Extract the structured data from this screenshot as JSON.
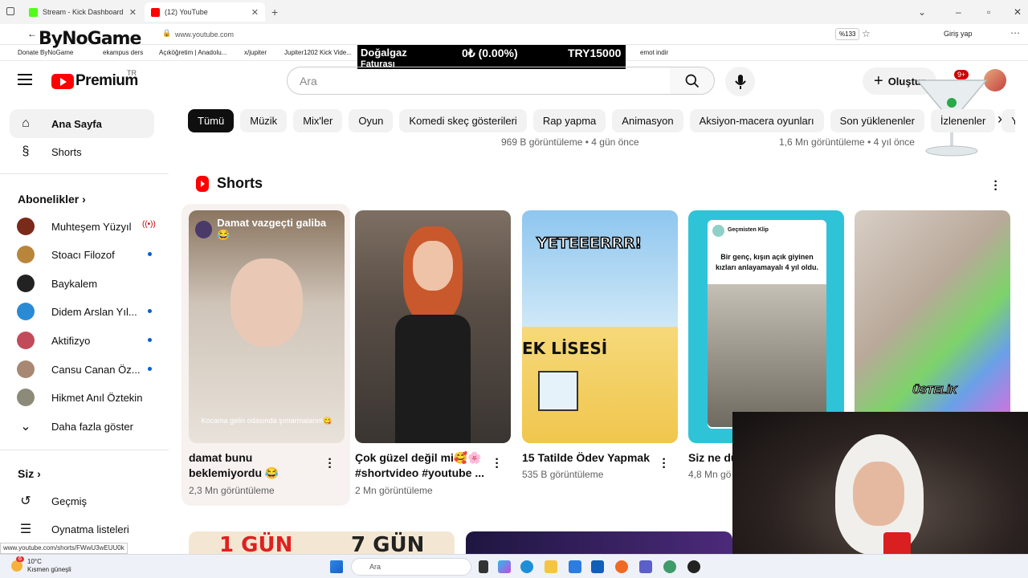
{
  "browser": {
    "tabs": [
      {
        "title": "Stream - Kick Dashboard",
        "favicon_color": "#53fc18"
      },
      {
        "title": "(12) YouTube",
        "favicon_color": "#ff0000"
      }
    ],
    "url": "www.youtube.com",
    "zoom": "%133",
    "signin_label": "Giriş yap",
    "bookmarks": [
      "Donate ByNoGame",
      "ekampus ders",
      "Açıköğretim | Anadolu...",
      "x/jupiter",
      "Jupiter1202 Kick Vide...",
      "emot indir"
    ],
    "status_url": "www.youtube.com/shorts/FWwU3wEUU0k"
  },
  "overlay": {
    "logo_text": "ByNoGame",
    "ticker_left": "Doğalgaz",
    "ticker_sub": "Faturası",
    "ticker_mid": "0₺ (0.00%)",
    "ticker_right": "TRY15000"
  },
  "header": {
    "brand": "Premium",
    "region": "TR",
    "search_placeholder": "Ara",
    "create_label": "Oluştur",
    "notification_count": "9+"
  },
  "sidebar": {
    "main": [
      {
        "label": "Ana Sayfa",
        "icon": "home-icon"
      },
      {
        "label": "Shorts",
        "icon": "shorts-icon"
      }
    ],
    "subscriptions_title": "Abonelikler",
    "subscriptions": [
      {
        "label": "Muhteşem Yüzyıl",
        "color": "#7a2a1a",
        "status": "live"
      },
      {
        "label": "Stoacı Filozof",
        "color": "#b8863b",
        "status": "new"
      },
      {
        "label": "Baykalem",
        "color": "#222222",
        "status": ""
      },
      {
        "label": "Didem Arslan Yıl...",
        "color": "#2a8ad4",
        "status": "new"
      },
      {
        "label": "Aktifizyo",
        "color": "#c24b5a",
        "status": "new"
      },
      {
        "label": "Cansu Canan Öz...",
        "color": "#a88872",
        "status": "new"
      },
      {
        "label": "Hikmet Anıl Öztekin",
        "color": "#8d8a7a",
        "status": ""
      }
    ],
    "show_more": "Daha fazla göster",
    "you_title": "Siz",
    "you_items": [
      {
        "label": "Geçmiş",
        "icon": "history-icon"
      },
      {
        "label": "Oynatma listeleri",
        "icon": "playlist-icon"
      }
    ]
  },
  "chips": [
    "Tümü",
    "Müzik",
    "Mix'ler",
    "Oyun",
    "Komedi skeç gösterileri",
    "Rap yapma",
    "Animasyon",
    "Aksiyon-macera oyunları",
    "Son yüklenenler",
    "İzlenenler",
    "Yo"
  ],
  "previous_row_meta": [
    "969 B görüntüleme • 4 gün önce",
    "1,6 Mn görüntüleme • 4 yıl önce"
  ],
  "shorts": {
    "title": "Shorts",
    "items": [
      {
        "title": "damat bunu beklemiyordu 😂",
        "views": "2,3 Mn görüntüleme",
        "overlay": "Damat vazgeçti galiba 😂",
        "caption": "Kocama gelin odasında şımarmalarım😋"
      },
      {
        "title": "Çok güzel değil mi🥰🌸 #shortvideo #youtube ...",
        "views": "2 Mn görüntüleme"
      },
      {
        "title": "15 Tatilde Ödev Yapmak",
        "views": "535 B görüntüleme",
        "overlay": "YETEEERRR!",
        "sign": "EK LİSESİ"
      },
      {
        "title": "Siz ne dü",
        "views": "4,8 Mn gö",
        "channel": "Geçmisten Klip",
        "overlay_text": "Bir genç, kışın açık giyinen kızları anlayamayalı 4 yıl oldu."
      },
      {
        "title": "",
        "views": "",
        "overlay": "ÜSTELİK"
      }
    ]
  },
  "bottom_row": [
    "1 GÜN",
    "7 GÜN"
  ],
  "taskbar": {
    "weather_badge": "6",
    "temperature": "10°C",
    "condition": "Kısmen güneşli",
    "search_label": "Ara"
  }
}
